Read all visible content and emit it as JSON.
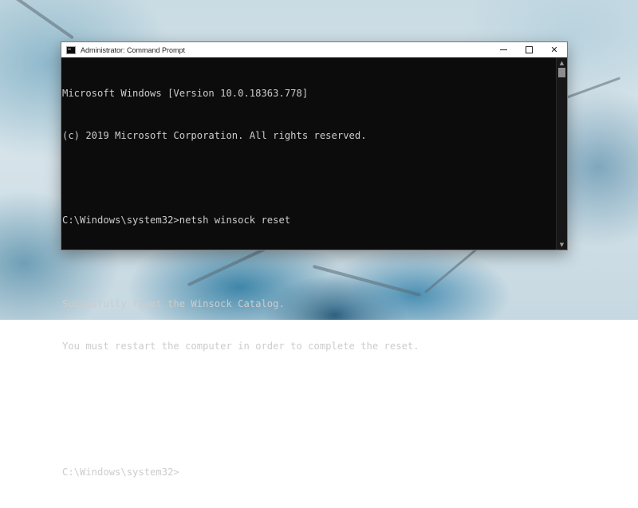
{
  "window": {
    "title": "Administrator: Command Prompt",
    "controls": {
      "minimize": "minimize-icon",
      "maximize": "maximize-icon",
      "close_glyph": "✕"
    }
  },
  "console": {
    "lines": [
      "Microsoft Windows [Version 10.0.18363.778]",
      "(c) 2019 Microsoft Corporation. All rights reserved.",
      "",
      "C:\\Windows\\system32>netsh winsock reset",
      "",
      "Sucessfully reset the Winsock Catalog.",
      "You must restart the computer in order to complete the reset.",
      "",
      "",
      "C:\\Windows\\system32>"
    ]
  },
  "scrollbar": {
    "up_glyph": "▲",
    "down_glyph": "▼"
  },
  "colors": {
    "console_bg": "#0c0c0c",
    "console_text": "#cccccc",
    "titlebar_bg": "#ffffff"
  }
}
